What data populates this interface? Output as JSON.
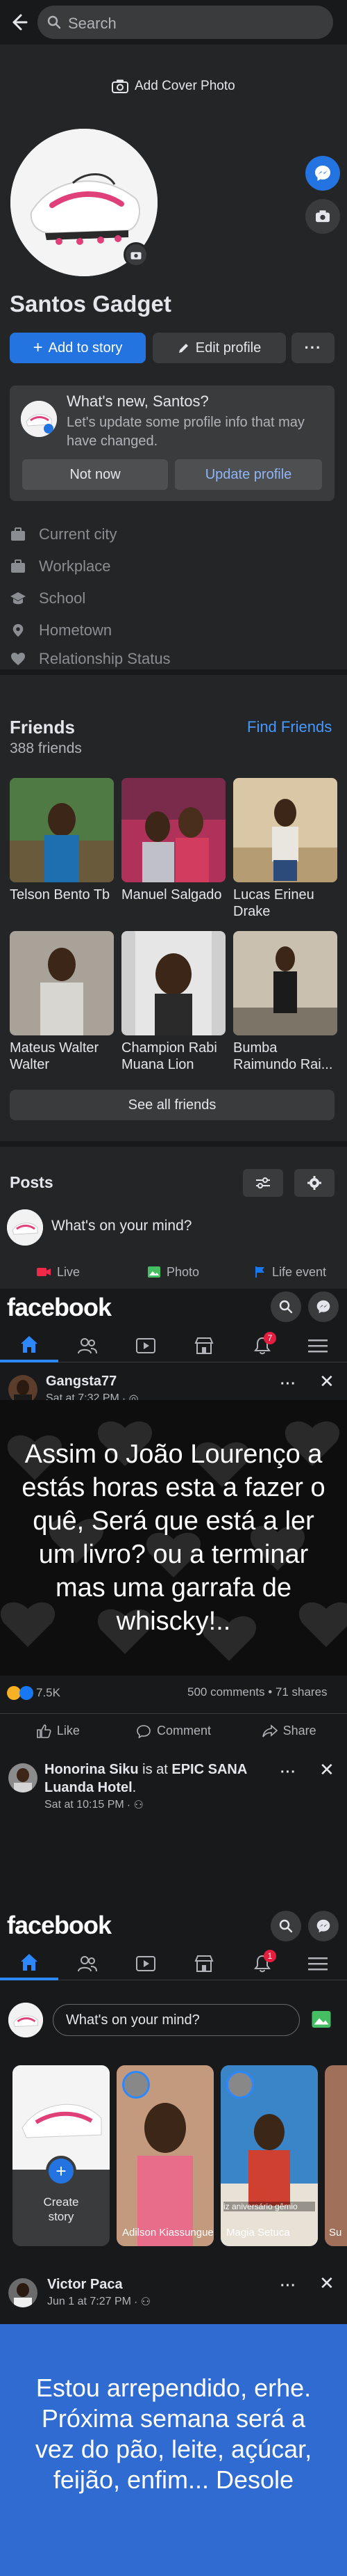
{
  "topbar": {
    "search_placeholder": "Search"
  },
  "profile": {
    "cover_button": "Add Cover Photo",
    "name": "Santos Gadget",
    "add_story": "Add to story",
    "edit_profile": "Edit profile",
    "more": "···"
  },
  "update_prompt": {
    "title": "What's new, Santos?",
    "body": "Let's update some profile info that may have changed.",
    "not_now": "Not now",
    "update": "Update profile"
  },
  "info_rows": [
    {
      "icon": "briefcase-icon",
      "label": "Current city"
    },
    {
      "icon": "work-icon",
      "label": "Workplace"
    },
    {
      "icon": "school-icon",
      "label": "School"
    },
    {
      "icon": "location-pin-icon",
      "label": "Hometown"
    },
    {
      "icon": "heart-icon",
      "label": "Relationship Status"
    }
  ],
  "friends": {
    "title": "Friends",
    "count": "388 friends",
    "find": "Find Friends",
    "see_all": "See all friends",
    "list": [
      {
        "name": "Telson Bento Tb"
      },
      {
        "name": "Manuel Salgado"
      },
      {
        "name": "Lucas Erineu Drake"
      },
      {
        "name": "Mateus Walter Walter"
      },
      {
        "name": "Champion Rabi Muana Lion"
      },
      {
        "name": "Bumba Raimundo Rai..."
      }
    ]
  },
  "posts": {
    "title": "Posts",
    "mind": "What's on your mind?",
    "actions": [
      "Live",
      "Photo",
      "Life event"
    ]
  },
  "feed1": {
    "logo": "facebook",
    "notif_badge": "7",
    "post": {
      "author": "Gangsta77",
      "time": "Sat at 7:32 PM",
      "text": "Assim o João Lourenço a estás horas esta a fazer o quê, Será que está a ler um livro? ou a terminar mas uma garrafa de whiscky!..",
      "reactions": "7.5K",
      "counts": "500 comments • 71 shares",
      "actions": [
        "Like",
        "Comment",
        "Share"
      ]
    },
    "checkin": {
      "author": "Honorina Siku",
      "is_at": " is at ",
      "place": "EPIC SANA Luanda Hotel",
      "time": "Sat at 10:15 PM"
    }
  },
  "feed2": {
    "logo": "facebook",
    "notif_badge": "1",
    "mind": "What's on your mind?",
    "stories": [
      {
        "label": "Create story"
      },
      {
        "label": "Adilson Kiassungue"
      },
      {
        "label": "Magia Setuca",
        "overlay": "iz aniversário gêmio"
      },
      {
        "label": "Su"
      }
    ],
    "post": {
      "author": "Victor Paca",
      "time": "Jun 1 at 7:27 PM",
      "text": "Estou arrependido, erhe. Próxima semana será a vez do pão, leite, açúcar, feijão, enfim... Desole"
    }
  },
  "colors": {
    "accent": "#2374e1",
    "link": "#4599ff",
    "bg": "#18191a",
    "card": "#242526",
    "blue_post": "#2f6bd1"
  }
}
